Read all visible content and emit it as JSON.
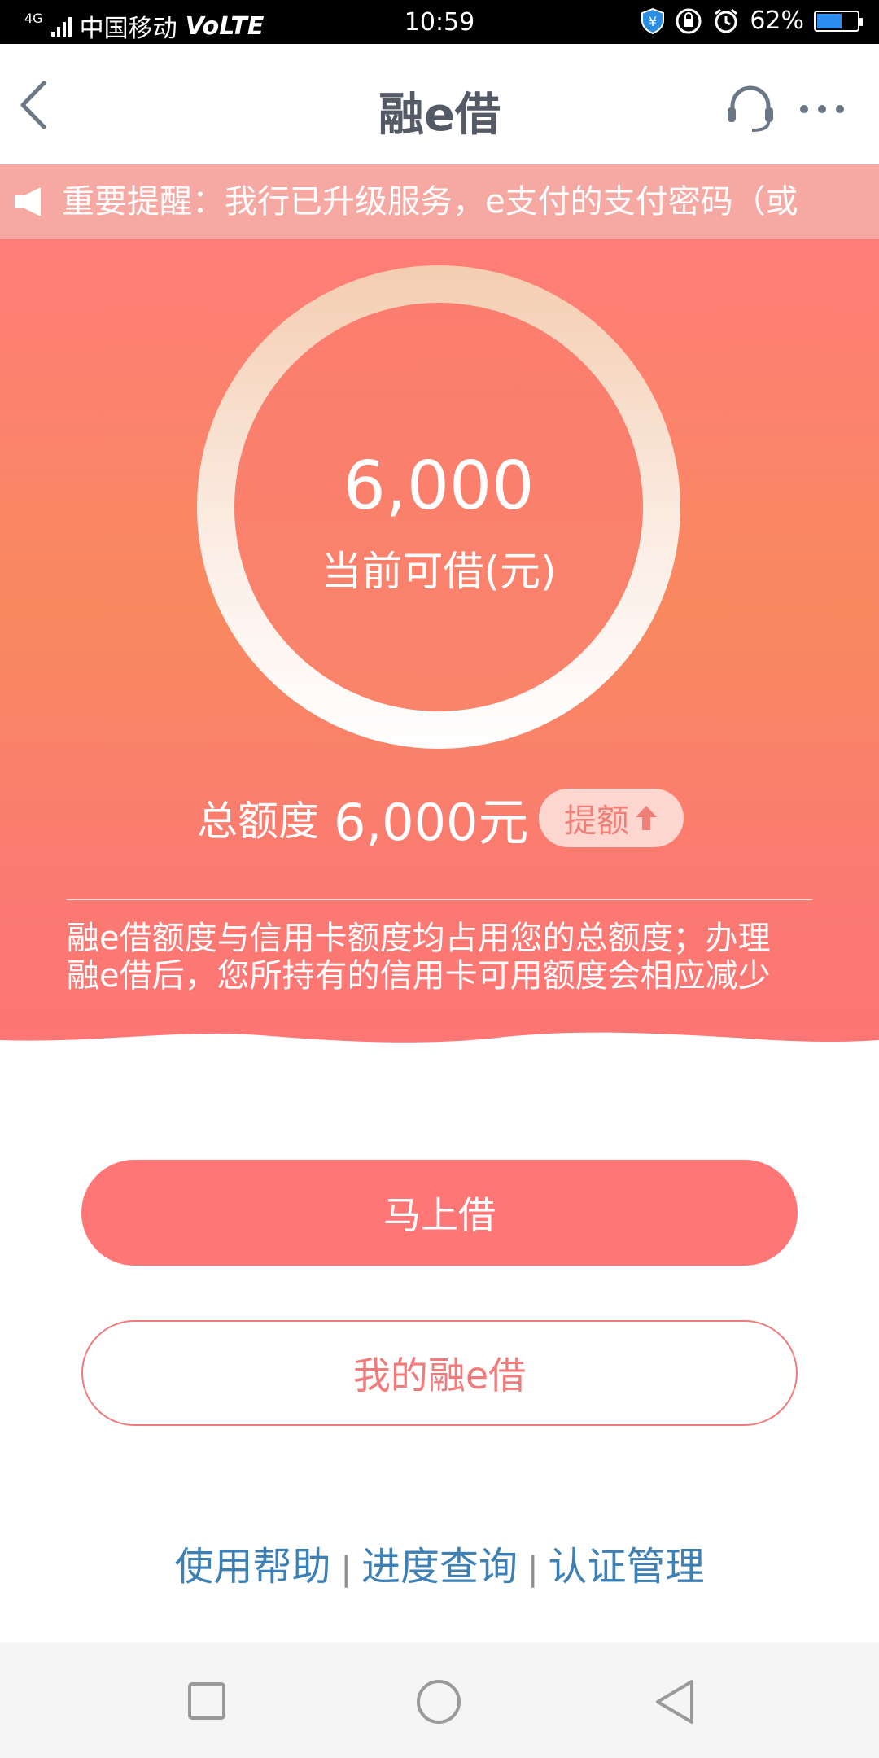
{
  "status_bar": {
    "carrier": "中国移动",
    "network": "4G",
    "volte": "VoLTE",
    "time": "10:59",
    "battery": "62%",
    "battery_level": 0.62
  },
  "header": {
    "title": "融e借"
  },
  "notice": {
    "text": "重要提醒：我行已升级服务，e支付的支付密码（或"
  },
  "hero": {
    "amount": "6,000",
    "amount_label": "当前可借(元)",
    "total_label": "总额度",
    "total_value": "6,000元",
    "raise_label": "提额",
    "description_line1": "融e借额度与信用卡额度均占用您的总额度；办理",
    "description_line2": "融e借后，您所持有的信用卡可用额度会相应减少"
  },
  "actions": {
    "borrow_now": "马上借",
    "my_loans": "我的融e借"
  },
  "footer_links": {
    "help": "使用帮助",
    "progress": "进度查询",
    "auth": "认证管理",
    "separator": "|"
  },
  "colors": {
    "accent": "#fe7675",
    "link": "#3d80b5",
    "hero_top": "#ff7d78",
    "hero_mid": "#f9895f"
  }
}
